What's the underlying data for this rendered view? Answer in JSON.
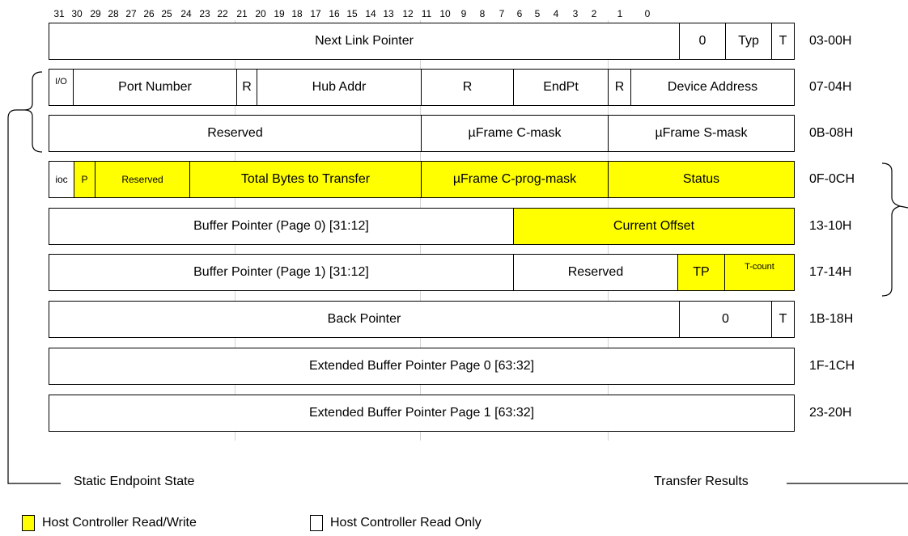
{
  "bit_numbers": [
    "31",
    "30",
    "29",
    "28",
    "27",
    "26",
    "25",
    "24",
    "23",
    "22",
    "21",
    "20",
    "19",
    "18",
    "17",
    "16",
    "15",
    "14",
    "13",
    "12",
    "11",
    "10",
    "9",
    "8",
    "7",
    "6",
    "5",
    "4",
    "3",
    "2",
    "1",
    "0"
  ],
  "fields": {
    "next_link_pointer": "Next Link Pointer",
    "nlp_zero": "0",
    "nlp_typ": "Typ",
    "nlp_t": "T",
    "io": "I/O",
    "port_number": "Port Number",
    "r1": "R",
    "hub_addr": "Hub Addr",
    "r2": "R",
    "endpt": "EndPt",
    "r3": "R",
    "device_address": "Device Address",
    "reserved_08": "Reserved",
    "uframe_cmask": "µFrame C-mask",
    "uframe_smask": "µFrame S-mask",
    "ioc": "ioc",
    "p": "P",
    "reserved_0c": "Reserved",
    "total_bytes": "Total Bytes to Transfer",
    "uframe_cprog": "µFrame C-prog-mask",
    "status": "Status",
    "buf_ptr_page0": "Buffer Pointer (Page 0) [31:12]",
    "current_offset": "Current Offset",
    "buf_ptr_page1": "Buffer Pointer (Page 1) [31:12]",
    "reserved_14": "Reserved",
    "tp": "TP",
    "t_count": "T-count",
    "back_pointer": "Back Pointer",
    "bp_zero": "0",
    "bp_t": "T",
    "ext_buf_0": "Extended Buffer Pointer Page 0 [63:32]",
    "ext_buf_1": "Extended Buffer Pointer Page 1 [63:32]"
  },
  "offsets": [
    "03-00H",
    "07-04H",
    "0B-08H",
    "0F-0CH",
    "13-10H",
    "17-14H",
    "1B-18H",
    "1F-1CH",
    "23-20H"
  ],
  "labels": {
    "static_endpoint_state": "Static Endpoint State",
    "transfer_results": "Transfer Results"
  },
  "legend": {
    "read_write": "Host Controller Read/Write",
    "read_only": "Host Controller Read Only"
  },
  "colors": {
    "host_controller_read_write": "#ffff00",
    "host_controller_read_only": "#ffffff"
  }
}
